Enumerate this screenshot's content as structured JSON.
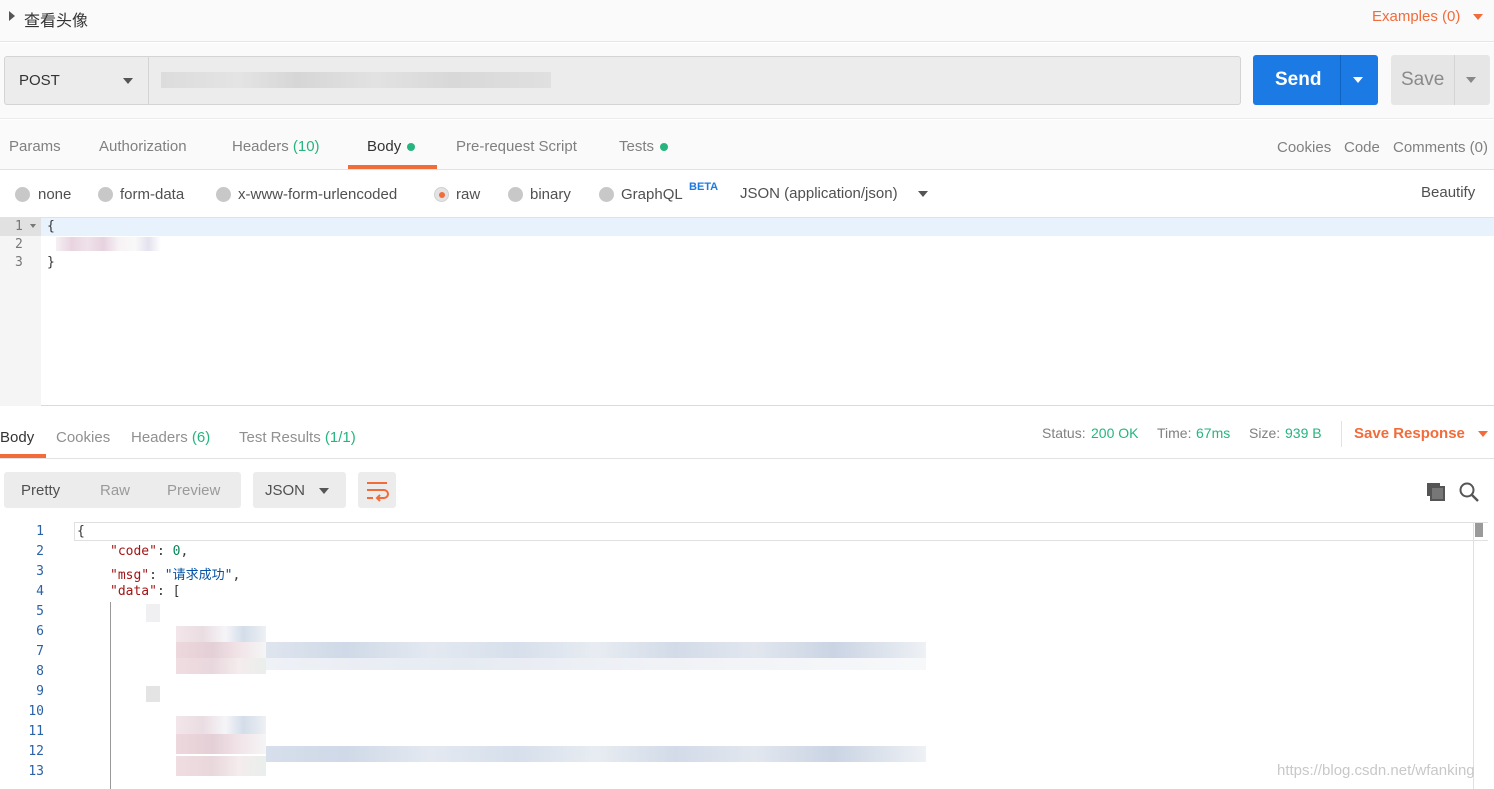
{
  "request": {
    "name": "查看头像",
    "examples_label": "Examples (0)",
    "method": "POST",
    "url": "",
    "send_label": "Send",
    "save_label": "Save"
  },
  "request_tabs": {
    "params": "Params",
    "authorization": "Authorization",
    "headers": "Headers",
    "headers_count": "(10)",
    "body": "Body",
    "prerequest": "Pre-request Script",
    "tests": "Tests",
    "cookies": "Cookies",
    "code": "Code",
    "comments": "Comments (0)"
  },
  "body_options": {
    "none": "none",
    "form_data": "form-data",
    "urlencoded": "x-www-form-urlencoded",
    "raw": "raw",
    "binary": "binary",
    "graphql": "GraphQL",
    "beta": "BETA",
    "content_type": "JSON (application/json)",
    "beautify": "Beautify",
    "selected": "raw"
  },
  "request_editor": {
    "line_numbers": [
      "1",
      "2",
      "3"
    ],
    "line1": "{",
    "line3": "}"
  },
  "response_tabs": {
    "body": "Body",
    "cookies": "Cookies",
    "headers": "Headers",
    "headers_count": "(6)",
    "test_results": "Test Results",
    "test_results_count": "(1/1)"
  },
  "response_status": {
    "status_label": "Status:",
    "status_value": "200 OK",
    "time_label": "Time:",
    "time_value": "67ms",
    "size_label": "Size:",
    "size_value": "939 B",
    "save_response": "Save Response"
  },
  "response_toolbar": {
    "pretty": "Pretty",
    "raw": "Raw",
    "preview": "Preview",
    "format": "JSON"
  },
  "response_body": {
    "line_numbers": [
      "1",
      "2",
      "3",
      "4",
      "5",
      "6",
      "7",
      "8",
      "9",
      "10",
      "11",
      "12",
      "13"
    ],
    "open_brace": "{",
    "code_key": "\"code\"",
    "code_value": "0",
    "msg_key": "\"msg\"",
    "msg_value": "\"请求成功\"",
    "data_key": "\"data\"",
    "data_open": "["
  },
  "watermark": "https://blog.csdn.net/wfanking",
  "colors": {
    "accent": "#f26b3a",
    "send_blue": "#1b7ae3",
    "status_green": "#26b47f"
  }
}
